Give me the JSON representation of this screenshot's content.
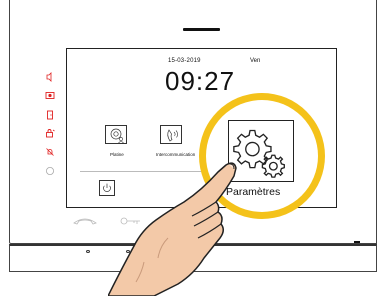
{
  "screen": {
    "date": "15-03-2019",
    "day": "Ven",
    "time": "09:27"
  },
  "tiles": [
    {
      "label": "Platine"
    },
    {
      "label": "Intercommunication"
    }
  ],
  "callout": {
    "label": "Paramètres"
  },
  "colors": {
    "accent_red": "#e02020",
    "callout_ring": "#f4c21a",
    "skin": "#f3c9a8",
    "outline": "#222222"
  },
  "icons": {
    "side": [
      "speaker-icon",
      "camera-icon",
      "door-icon",
      "lock-icon",
      "bell-off-icon",
      "circle-icon"
    ],
    "tiles": [
      "camera-user-icon",
      "phone-icon",
      "gear-icon"
    ],
    "bottom": [
      "hang-up-icon",
      "key-icon",
      "power-icon"
    ]
  }
}
